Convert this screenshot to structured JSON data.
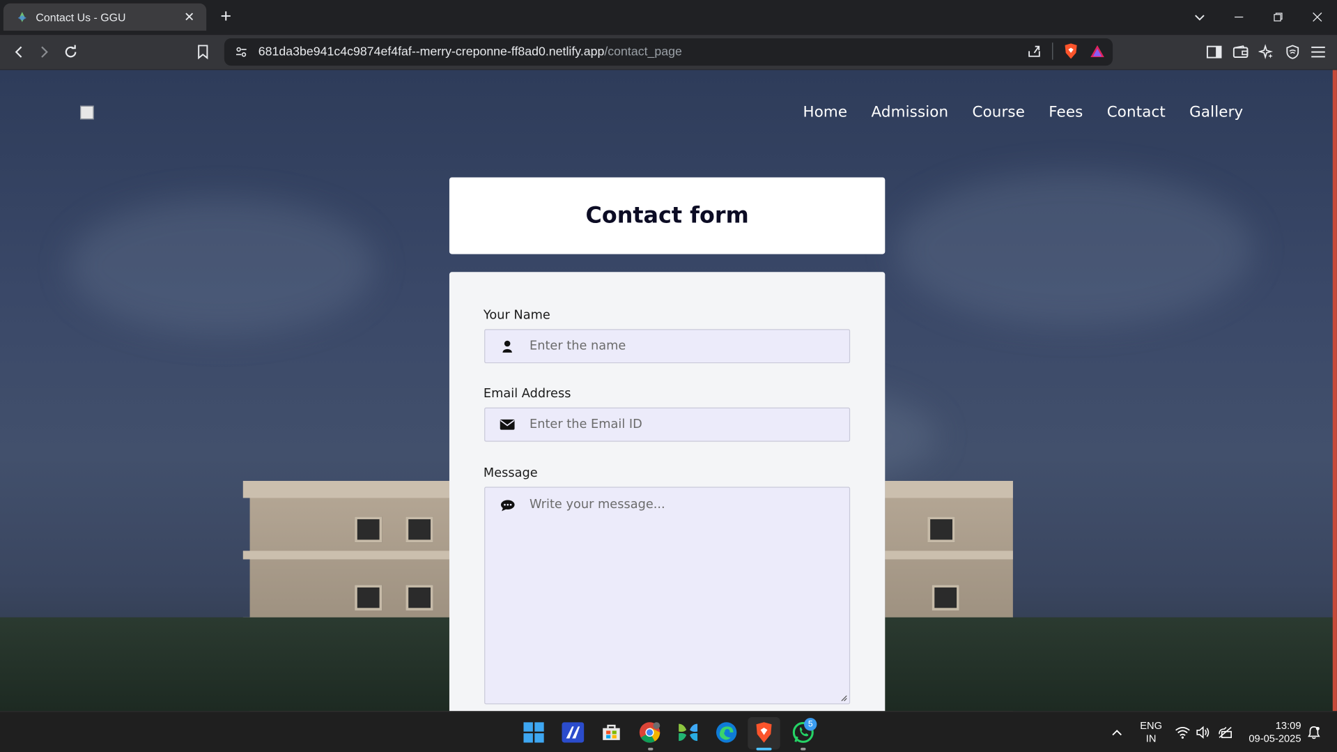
{
  "browser": {
    "tab_title": "Contact Us - GGU",
    "url_host": "681da3be941c4c9874ef4faf--merry-creponne-ff8ad0.netlify.app",
    "url_path": "/contact_page"
  },
  "site": {
    "nav": [
      "Home",
      "Admission",
      "Course",
      "Fees",
      "Contact",
      "Gallery"
    ]
  },
  "form": {
    "title": "Contact form",
    "name_label": "Your Name",
    "name_placeholder": "Enter the name",
    "email_label": "Email Address",
    "email_placeholder": "Enter the Email ID",
    "message_label": "Message",
    "message_placeholder": "Write your message..."
  },
  "taskbar": {
    "whatsapp_badge": "5",
    "language": "ENG",
    "region": "IN",
    "time": "13:09",
    "date": "09-05-2025"
  },
  "colors": {
    "brave_orange": "#fb542b",
    "field_bg": "#ecebfa",
    "accent_blue": "#4cc2ff"
  }
}
